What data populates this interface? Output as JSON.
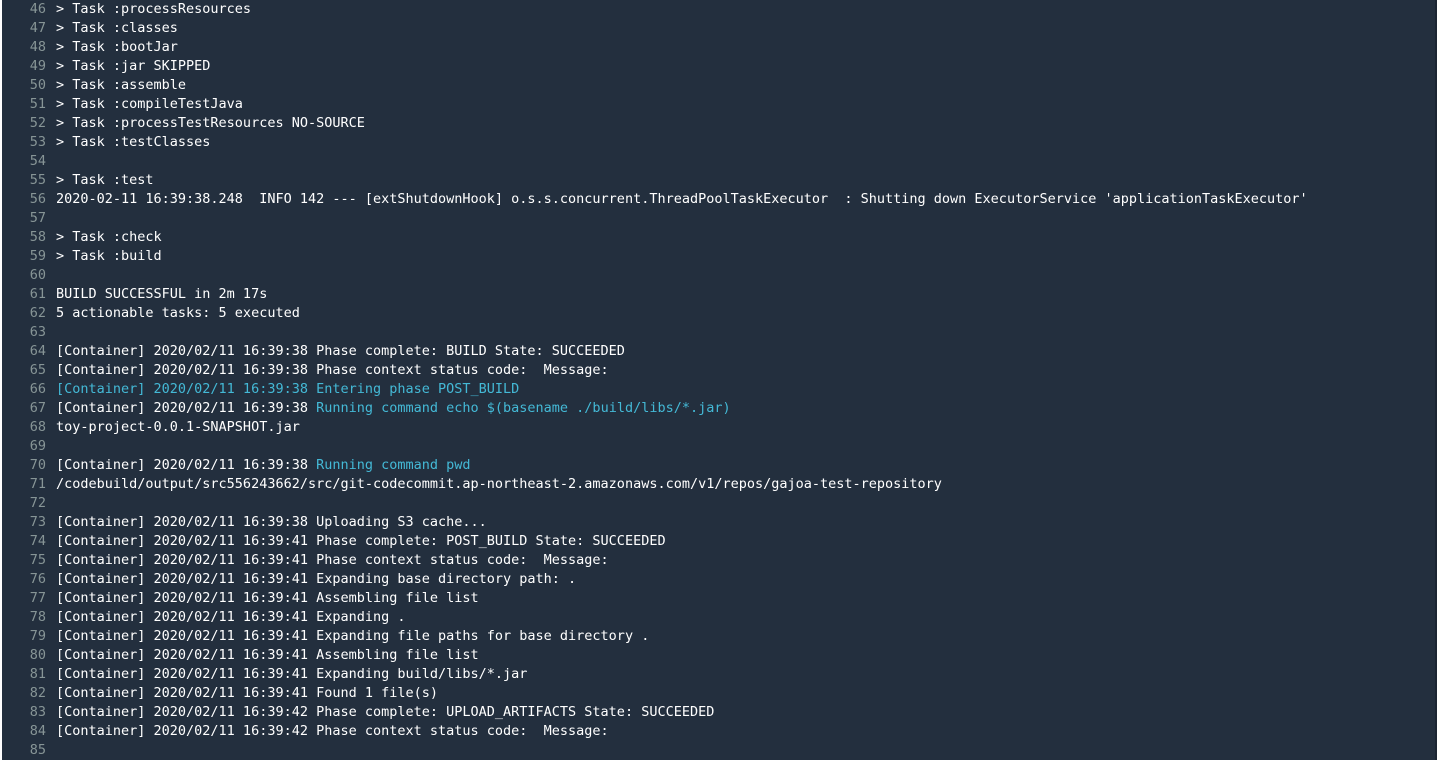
{
  "log": {
    "lines": [
      {
        "num": "46",
        "prefix": "> Task :processResources",
        "command": ""
      },
      {
        "num": "47",
        "prefix": "> Task :classes",
        "command": ""
      },
      {
        "num": "48",
        "prefix": "> Task :bootJar",
        "command": ""
      },
      {
        "num": "49",
        "prefix": "> Task :jar SKIPPED",
        "command": ""
      },
      {
        "num": "50",
        "prefix": "> Task :assemble",
        "command": ""
      },
      {
        "num": "51",
        "prefix": "> Task :compileTestJava",
        "command": ""
      },
      {
        "num": "52",
        "prefix": "> Task :processTestResources NO-SOURCE",
        "command": ""
      },
      {
        "num": "53",
        "prefix": "> Task :testClasses",
        "command": ""
      },
      {
        "num": "54",
        "prefix": "",
        "command": ""
      },
      {
        "num": "55",
        "prefix": "> Task :test",
        "command": ""
      },
      {
        "num": "56",
        "prefix": "2020-02-11 16:39:38.248  INFO 142 --- [extShutdownHook] o.s.s.concurrent.ThreadPoolTaskExecutor  : Shutting down ExecutorService 'applicationTaskExecutor'",
        "command": ""
      },
      {
        "num": "57",
        "prefix": "",
        "command": ""
      },
      {
        "num": "58",
        "prefix": "> Task :check",
        "command": ""
      },
      {
        "num": "59",
        "prefix": "> Task :build",
        "command": ""
      },
      {
        "num": "60",
        "prefix": "",
        "command": ""
      },
      {
        "num": "61",
        "prefix": "BUILD SUCCESSFUL in 2m 17s",
        "command": ""
      },
      {
        "num": "62",
        "prefix": "5 actionable tasks: 5 executed",
        "command": ""
      },
      {
        "num": "63",
        "prefix": "",
        "command": ""
      },
      {
        "num": "64",
        "prefix": "[Container] 2020/02/11 16:39:38 Phase complete: BUILD State: SUCCEEDED",
        "command": ""
      },
      {
        "num": "65",
        "prefix": "[Container] 2020/02/11 16:39:38 Phase context status code:  Message:",
        "command": ""
      },
      {
        "num": "66",
        "prefix": "",
        "command": "[Container] 2020/02/11 16:39:38 Entering phase POST_BUILD"
      },
      {
        "num": "67",
        "prefix": "[Container] 2020/02/11 16:39:38 ",
        "command": "Running command echo $(basename ./build/libs/*.jar)"
      },
      {
        "num": "68",
        "prefix": "toy-project-0.0.1-SNAPSHOT.jar",
        "command": ""
      },
      {
        "num": "69",
        "prefix": "",
        "command": ""
      },
      {
        "num": "70",
        "prefix": "[Container] 2020/02/11 16:39:38 ",
        "command": "Running command pwd"
      },
      {
        "num": "71",
        "prefix": "/codebuild/output/src556243662/src/git-codecommit.ap-northeast-2.amazonaws.com/v1/repos/gajoa-test-repository",
        "command": ""
      },
      {
        "num": "72",
        "prefix": "",
        "command": ""
      },
      {
        "num": "73",
        "prefix": "[Container] 2020/02/11 16:39:38 Uploading S3 cache...",
        "command": ""
      },
      {
        "num": "74",
        "prefix": "[Container] 2020/02/11 16:39:41 Phase complete: POST_BUILD State: SUCCEEDED",
        "command": ""
      },
      {
        "num": "75",
        "prefix": "[Container] 2020/02/11 16:39:41 Phase context status code:  Message:",
        "command": ""
      },
      {
        "num": "76",
        "prefix": "[Container] 2020/02/11 16:39:41 Expanding base directory path: .",
        "command": ""
      },
      {
        "num": "77",
        "prefix": "[Container] 2020/02/11 16:39:41 Assembling file list",
        "command": ""
      },
      {
        "num": "78",
        "prefix": "[Container] 2020/02/11 16:39:41 Expanding .",
        "command": ""
      },
      {
        "num": "79",
        "prefix": "[Container] 2020/02/11 16:39:41 Expanding file paths for base directory .",
        "command": ""
      },
      {
        "num": "80",
        "prefix": "[Container] 2020/02/11 16:39:41 Assembling file list",
        "command": ""
      },
      {
        "num": "81",
        "prefix": "[Container] 2020/02/11 16:39:41 Expanding build/libs/*.jar",
        "command": ""
      },
      {
        "num": "82",
        "prefix": "[Container] 2020/02/11 16:39:41 Found 1 file(s)",
        "command": ""
      },
      {
        "num": "83",
        "prefix": "[Container] 2020/02/11 16:39:42 Phase complete: UPLOAD_ARTIFACTS State: SUCCEEDED",
        "command": ""
      },
      {
        "num": "84",
        "prefix": "[Container] 2020/02/11 16:39:42 Phase context status code:  Message:",
        "command": ""
      },
      {
        "num": "85",
        "prefix": "",
        "command": ""
      }
    ]
  },
  "colors": {
    "background": "#232f3e",
    "text": "#ffffff",
    "line_number": "#879596",
    "command": "#44b9d6"
  }
}
